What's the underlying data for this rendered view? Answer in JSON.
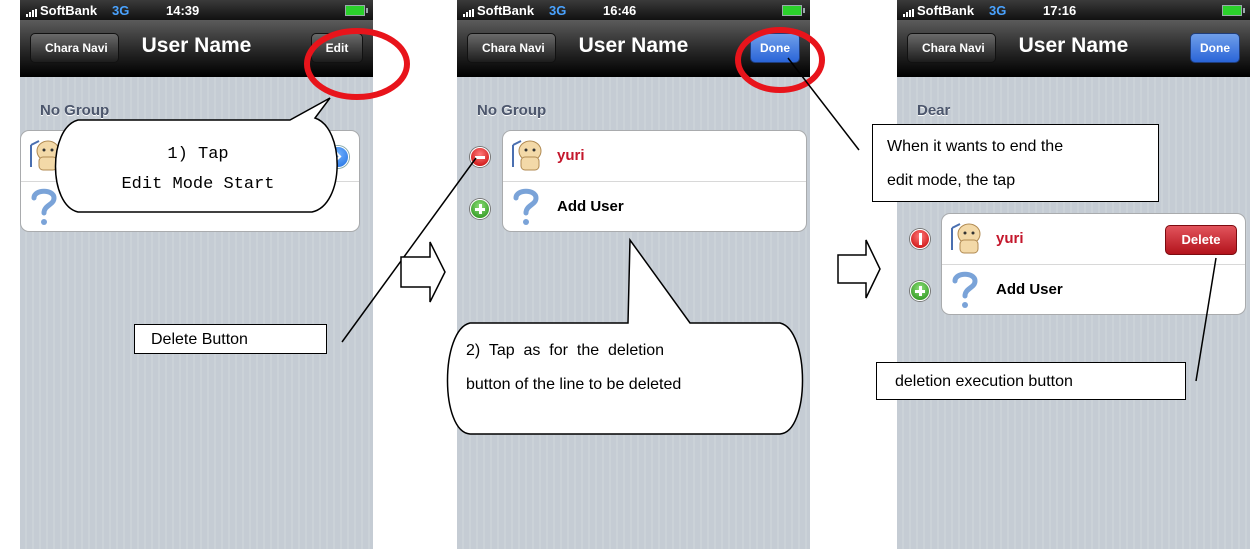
{
  "screens": [
    {
      "status": {
        "carrier": "SoftBank",
        "network": "3G",
        "time": "14:39"
      },
      "nav": {
        "back": "Chara Navi",
        "title": "User Name",
        "action": "Edit"
      },
      "section": "No Group"
    },
    {
      "status": {
        "carrier": "SoftBank",
        "network": "3G",
        "time": "16:46"
      },
      "nav": {
        "back": "Chara Navi",
        "title": "User Name",
        "action": "Done"
      },
      "section": "No Group",
      "rows": [
        "yuri",
        "Add User"
      ]
    },
    {
      "status": {
        "carrier": "SoftBank",
        "network": "3G",
        "time": "17:16"
      },
      "nav": {
        "back": "Chara Navi",
        "title": "User Name",
        "action": "Done"
      },
      "section": "Dear",
      "rows": [
        "yuri",
        "Add User"
      ],
      "delete_label": "Delete"
    }
  ],
  "annotations": {
    "bubble1_line1": "1)  Tap",
    "bubble1_line2": "Edit Mode Start",
    "delete_button_box": "Delete Button",
    "bubble2_line1": "2)  Tap  as  for  the  deletion",
    "bubble2_line2": "button of the line to be deleted",
    "done_box_line1": "When it wants to end the",
    "done_box_line2": "edit mode, the tap",
    "exec_box": "deletion execution button"
  },
  "colors": {
    "highlight_circle": "#e8141b",
    "row_name": "#c4172c",
    "done_blue": "#2a65d8",
    "delete_red": "#c4172c"
  }
}
